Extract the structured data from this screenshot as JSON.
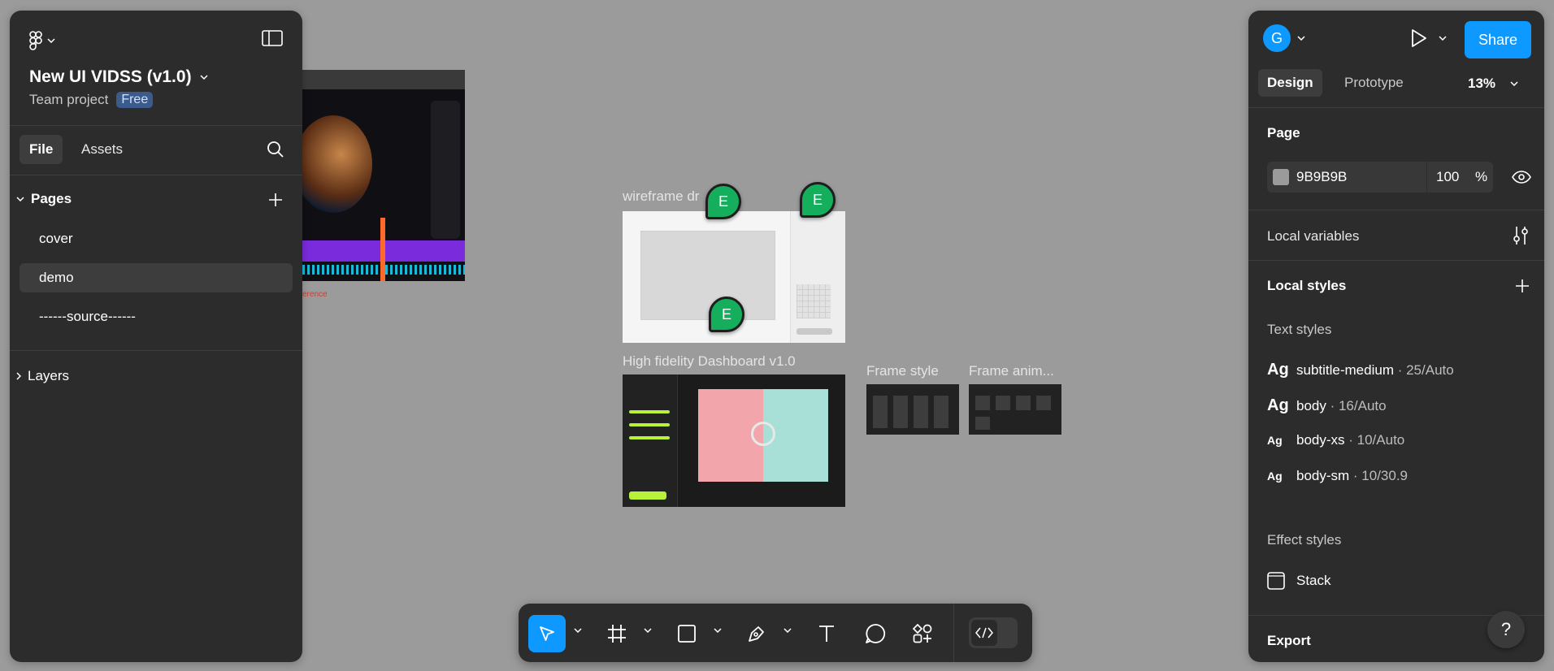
{
  "colors": {
    "canvas": "#9B9B9B",
    "panel": "#2c2c2c",
    "accent": "#0d99ff",
    "badge": "#3b5b8c",
    "presence": "#14ae5c"
  },
  "file": {
    "name": "New UI VIDSS (v1.0)",
    "team": "Team project",
    "plan_badge": "Free"
  },
  "left_tabs": {
    "file": "File",
    "assets": "Assets"
  },
  "pages": {
    "heading": "Pages",
    "items": [
      "cover",
      "demo",
      "------source------"
    ],
    "active": "demo"
  },
  "layers": {
    "heading": "Layers"
  },
  "canvas": {
    "frame1_label": "wireframe dr",
    "frame2_label": "High fidelity Dashboard v1.0",
    "frame3_label": "Frame style",
    "frame4_label": "Frame anim...",
    "frame0_sublabel": "erence",
    "markers": [
      "E",
      "E",
      "E"
    ]
  },
  "header": {
    "avatar": "G",
    "share": "Share"
  },
  "right_tabs": {
    "design": "Design",
    "prototype": "Prototype",
    "zoom": "13%"
  },
  "page_section": {
    "heading": "Page",
    "fill_hex": "9B9B9B",
    "opacity": "100",
    "percent": "%"
  },
  "local_variables": "Local variables",
  "local_styles": "Local styles",
  "text_styles": {
    "heading": "Text styles",
    "items": [
      {
        "ag": "Ag",
        "name": "subtitle-medium",
        "meta": " · 25/Auto"
      },
      {
        "ag": "Ag",
        "name": "body",
        "meta": " · 16/Auto"
      },
      {
        "ag": "Ag",
        "name": "body-xs",
        "meta": " · 10/Auto"
      },
      {
        "ag": "Ag",
        "name": "body-sm",
        "meta": " · 10/30.9"
      }
    ]
  },
  "effect_styles": {
    "heading": "Effect styles",
    "items": [
      "Stack"
    ]
  },
  "export": "Export",
  "help": "?",
  "toolbar": {
    "tools": [
      "move-tool",
      "frame-tool",
      "shape-tool",
      "pen-tool",
      "text-tool",
      "comment-tool",
      "actions-tool",
      "dev-mode-toggle"
    ]
  }
}
